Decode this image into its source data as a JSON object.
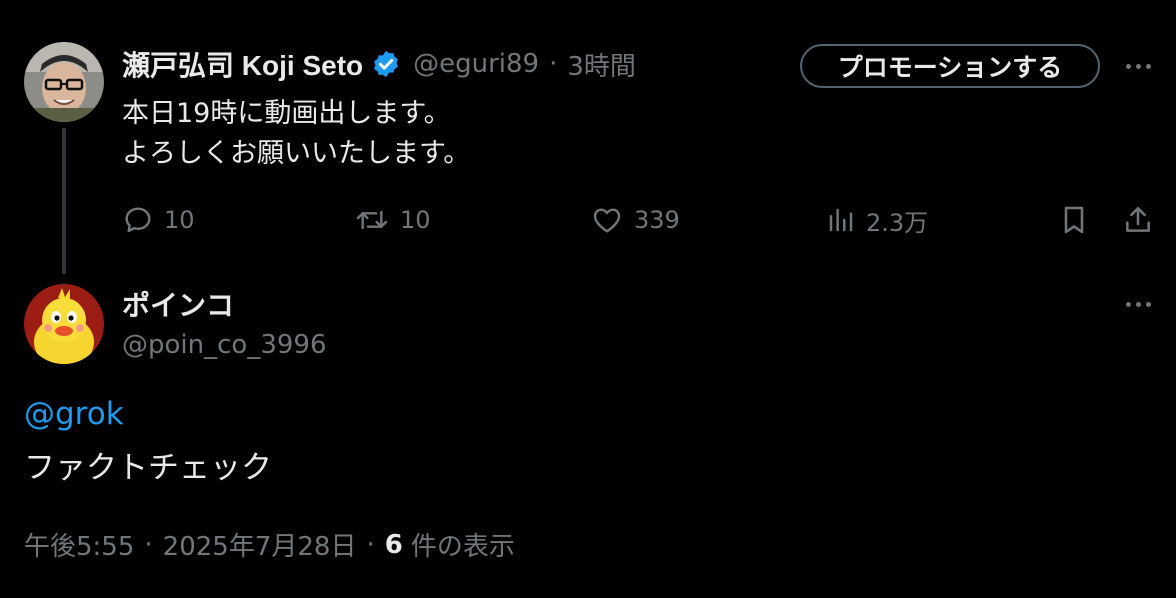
{
  "parent_tweet": {
    "author_name": "瀬戸弘司 Koji Seto",
    "handle": "@eguri89",
    "separator": "·",
    "time": "3時間",
    "promote_label": "プロモーションする",
    "text": "本日19時に動画出します。\nよろしくお願いいたします。",
    "actions": {
      "replies": "10",
      "reposts": "10",
      "likes": "339",
      "views": "2.3万"
    }
  },
  "reply_tweet": {
    "author_name": "ポインコ",
    "handle": "@poin_co_3996",
    "mention": "@grok",
    "text": "ファクトチェック",
    "time": "午後5:55",
    "date": "2025年7月28日",
    "separator": "·",
    "view_count": "6",
    "view_label": "件の表示"
  },
  "icons": {
    "verified": "verified-badge-icon",
    "reply": "reply-icon",
    "repost": "repost-icon",
    "like": "like-icon",
    "views": "views-icon",
    "bookmark": "bookmark-icon",
    "share": "share-icon",
    "more": "more-icon"
  },
  "colors": {
    "background": "#000000",
    "text_primary": "#e7e9ea",
    "text_secondary": "#71767b",
    "accent": "#1d9bf0",
    "thread_line": "#333639"
  }
}
